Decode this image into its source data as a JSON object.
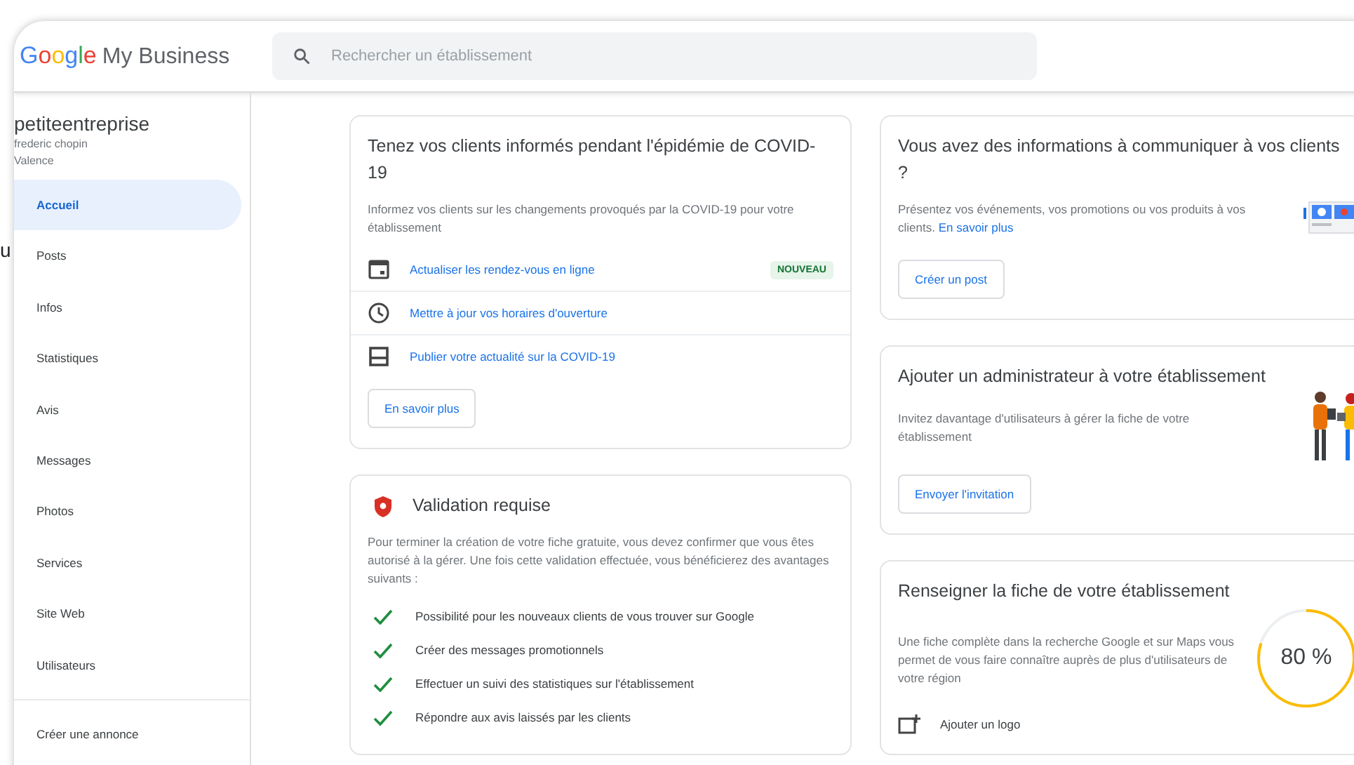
{
  "stray_text": "u",
  "header": {
    "logo_google": "Google",
    "logo_product": "My Business",
    "search": {
      "placeholder": "Rechercher un établissement"
    }
  },
  "sidebar": {
    "business_name": "petiteentreprise",
    "address_lines": [
      "frederic chopin",
      "Valence"
    ],
    "items": [
      {
        "label": "Accueil",
        "selected": true
      },
      {
        "label": "Posts",
        "selected": false
      },
      {
        "label": "Infos",
        "selected": false
      },
      {
        "label": "Statistiques",
        "selected": false
      },
      {
        "label": "Avis",
        "selected": false
      },
      {
        "label": "Messages",
        "selected": false
      },
      {
        "label": "Photos",
        "selected": false
      },
      {
        "label": "Services",
        "selected": false
      },
      {
        "label": "Site Web",
        "selected": false
      },
      {
        "label": "Utilisateurs",
        "selected": false
      }
    ],
    "footer_item": "Créer une annonce"
  },
  "covid_card": {
    "title": "Tenez vos clients informés pendant l'épidémie de COVID-19",
    "description": "Informez vos clients sur les changements provoqués par la COVID-19 pour votre établissement",
    "actions": [
      {
        "kind": "calendar",
        "label": "Actualiser les rendez-vous en ligne",
        "badge": "NOUVEAU"
      },
      {
        "kind": "clock",
        "label": "Mettre à jour vos horaires d'ouverture"
      },
      {
        "kind": "post",
        "label": "Publier votre actualité sur la COVID-19"
      }
    ],
    "button": "En savoir plus"
  },
  "validation_card": {
    "title": "Validation requise",
    "description": "Pour terminer la création de votre fiche gratuite, vous devez confirmer que vous êtes autorisé à la gérer. Une fois cette validation effectuée, vous bénéficierez des avantages suivants :",
    "benefits": [
      "Possibilité pour les nouveaux clients de vous trouver sur Google",
      "Créer des messages promotionnels",
      "Effectuer un suivi des statistiques sur l'établissement",
      "Répondre aux avis laissés par les clients"
    ]
  },
  "post_card": {
    "title": "Vous avez des informations à communiquer à vos clients ?",
    "description": "Présentez vos événements, vos promotions ou vos produits à vos clients.",
    "link": "En savoir plus",
    "button": "Créer un post"
  },
  "admin_card": {
    "title": "Ajouter un administrateur à votre établissement",
    "description": "Invitez davantage d'utilisateurs à gérer la fiche de votre établissement",
    "button": "Envoyer l'invitation"
  },
  "profile_card": {
    "title": "Renseigner la fiche de votre établissement",
    "description": "Une fiche complète dans la recherche Google et sur Maps vous permet de vous faire connaître auprès de plus d'utilisateurs de votre région",
    "progress": {
      "level": 0.8,
      "reading": "80 %"
    },
    "item": "Ajouter un logo"
  }
}
